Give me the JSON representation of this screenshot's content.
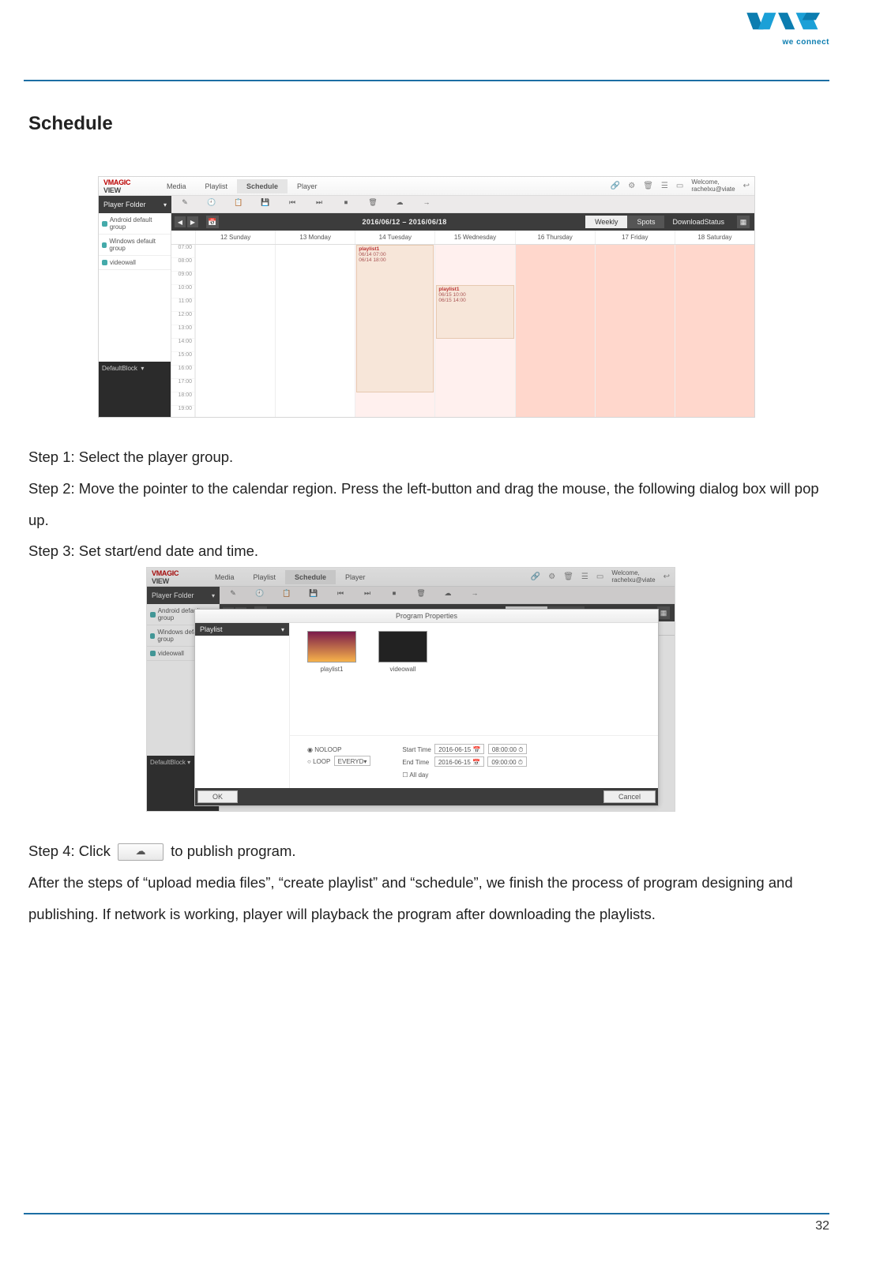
{
  "header_logo_tagline": "we connect",
  "doc": {
    "title": "Schedule",
    "step1": "Step 1: Select the player group.",
    "step2": "Step 2: Move the pointer to the calendar region. Press the left-button and drag the mouse, the following dialog box will pop up.",
    "step3": "Step 3: Set start/end date and time.",
    "step4_a": "Step 4: Click ",
    "step4_b": " to publish program.",
    "closing": "After the steps of “upload media files”, “create playlist” and “schedule”, we finish the process of program designing and publishing. If network is working, player will playback the program after downloading the playlists.",
    "page_number": "32"
  },
  "app": {
    "logo_line1": "MAGIC",
    "logo_line2": "VIEW",
    "tabs": [
      "Media",
      "Playlist",
      "Schedule",
      "Player"
    ],
    "active_tab": "Schedule",
    "top_icons": [
      "°°",
      "⚙",
      "⚑",
      "▤",
      "□"
    ],
    "welcome1": "Welcome,",
    "welcome2": "rachelxu@viate",
    "sidebar_title": "Player Folder",
    "sidebar_items": [
      "Android default group",
      "Windows default group",
      "videowall"
    ],
    "default_block": "DefaultBlock",
    "date_range": "2016/06/12 – 2016/06/18",
    "view_segs": [
      "Weekly",
      "Spots"
    ],
    "view_active": "Weekly",
    "dl_status": "DownloadStatus",
    "day_headers": [
      "12 Sunday",
      "13 Monday",
      "14 Tuesday",
      "15 Wednesday",
      "16 Thursday",
      "17 Friday",
      "18 Saturday"
    ],
    "time_slots": [
      "07:00",
      "08:00",
      "09:00",
      "10:00",
      "11:00",
      "12:00",
      "13:00",
      "14:00",
      "15:00",
      "16:00",
      "17:00",
      "18:00",
      "19:00"
    ],
    "events": {
      "tue": {
        "title": "playlist1",
        "l1": "06/14 07:00",
        "l2": "06/14 18:00"
      },
      "wed": {
        "title": "playlist1",
        "l1": "06/15 10:00",
        "l2": "06/15 14:00"
      }
    }
  },
  "dialog": {
    "title": "Program Properties",
    "left_title": "Playlist",
    "thumbs": [
      "playlist1",
      "videowall"
    ],
    "noloop": "NOLOOP",
    "loop": "LOOP",
    "loop_sel": "EVERYD▾",
    "start_label": "Start Time",
    "end_label": "End Time",
    "start_date": "2016-06-15",
    "start_time": "08:00:00",
    "end_date": "2016-06-15",
    "end_time": "09:00:00",
    "allday": "All day",
    "ok": "OK",
    "cancel": "Cancel"
  }
}
